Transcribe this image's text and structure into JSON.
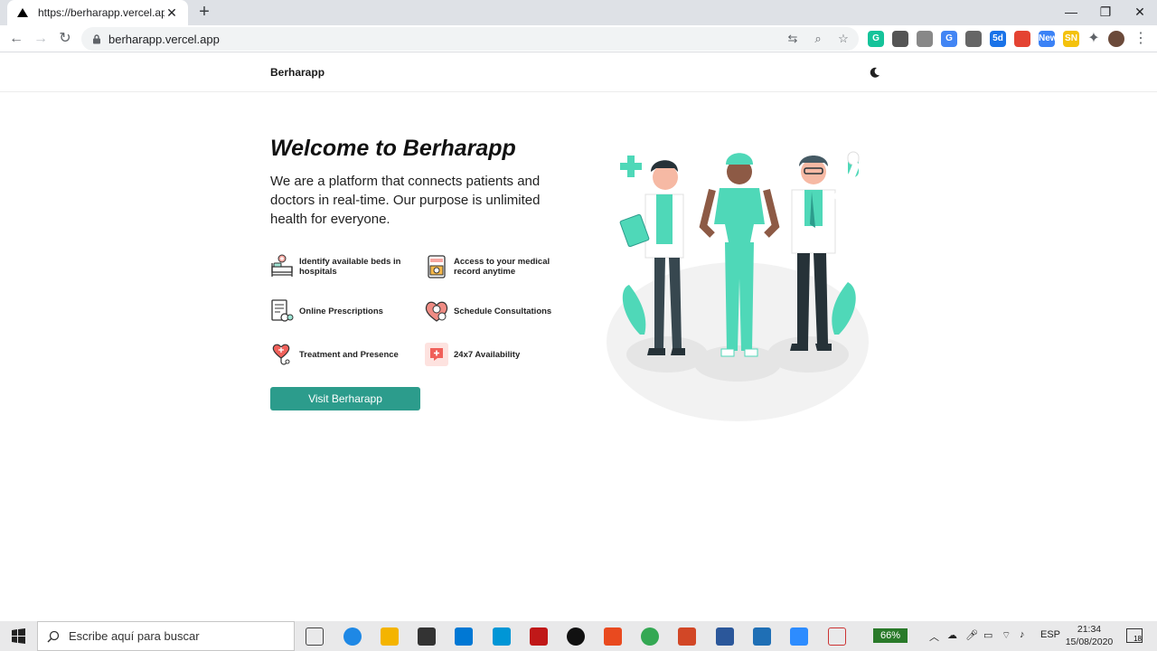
{
  "browser": {
    "tab_title": "https://berharapp.vercel.app",
    "url": "berharapp.vercel.app",
    "extensions": [
      {
        "name": "grammarly-extension-icon",
        "color": "#15c39a",
        "label": "G"
      },
      {
        "name": "extension-icon-2",
        "color": "#555555",
        "label": ""
      },
      {
        "name": "extension-icon-3",
        "color": "#888888",
        "label": ""
      },
      {
        "name": "translate-extension-icon",
        "color": "#4285f4",
        "label": "G"
      },
      {
        "name": "extension-icon-5",
        "color": "#666666",
        "label": ""
      },
      {
        "name": "extension-icon-6",
        "color": "#1a73e8",
        "label": "5d"
      },
      {
        "name": "todoist-extension-icon",
        "color": "#e44332",
        "label": ""
      },
      {
        "name": "new-extension-icon",
        "color": "#3b82f6",
        "label": "New"
      },
      {
        "name": "sn-extension-icon",
        "color": "#f4c20d",
        "label": "SN"
      }
    ]
  },
  "header": {
    "brand": "Berharapp"
  },
  "hero": {
    "title": "Welcome to Berharapp",
    "subtitle": "We are a platform that connects patients and doctors in real-time. Our purpose is unlimited health for everyone.",
    "features": [
      {
        "label": "Identify available beds in hospitals",
        "icon": "hospital-bed-icon"
      },
      {
        "label": "Access to your medical record anytime",
        "icon": "medical-record-icon"
      },
      {
        "label": "Online Prescriptions",
        "icon": "prescription-icon"
      },
      {
        "label": "Schedule Consultations",
        "icon": "consultation-icon"
      },
      {
        "label": "Treatment and Presence",
        "icon": "heart-stethoscope-icon"
      },
      {
        "label": "24x7 Availability",
        "icon": "first-aid-chat-icon"
      }
    ],
    "cta": "Visit Berharapp"
  },
  "colors": {
    "accent": "#2c9c8c",
    "illustration_mint": "#4fd8b8"
  },
  "taskbar": {
    "search_placeholder": "Escribe aquí para buscar",
    "battery": "66%",
    "language": "ESP",
    "time": "21:34",
    "date": "15/08/2020",
    "notifications": "18"
  }
}
